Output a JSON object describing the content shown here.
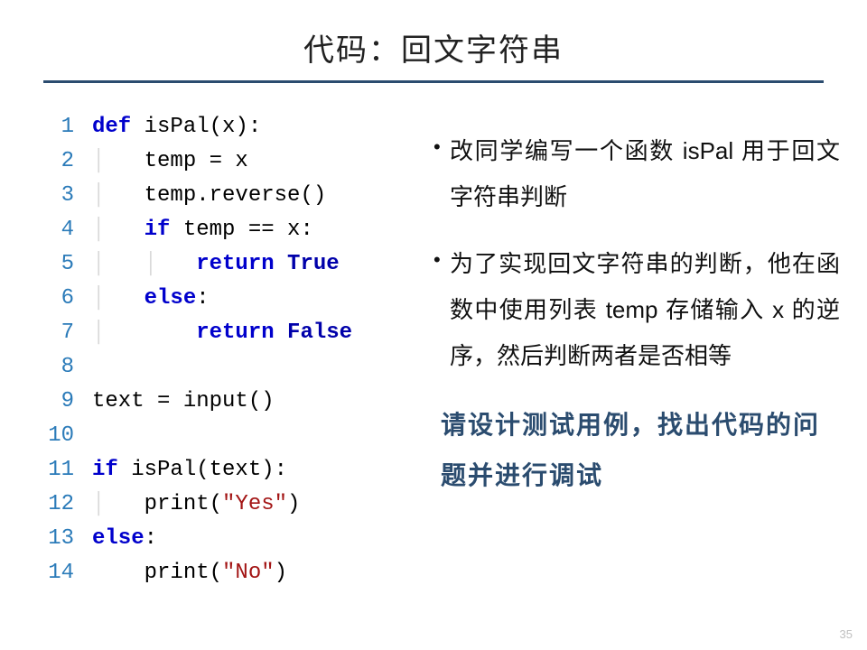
{
  "title": "代码：回文字符串",
  "code": {
    "lines": [
      {
        "n": 1,
        "html": "<span class='kw'>def</span> <span class='fn'>isPal</span><span class='txt'>(x):</span>"
      },
      {
        "n": 2,
        "html": "<span class='guide'>│   </span><span class='txt'>temp = x</span>"
      },
      {
        "n": 3,
        "html": "<span class='guide'>│   </span><span class='txt'>temp.reverse()</span>"
      },
      {
        "n": 4,
        "html": "<span class='guide'>│   </span><span class='kw'>if</span><span class='txt'> temp == x:</span>"
      },
      {
        "n": 5,
        "html": "<span class='guide'>│   │   </span><span class='kw'>return</span> <span class='bool'>True</span>"
      },
      {
        "n": 6,
        "html": "<span class='guide'>│   </span><span class='kw'>else</span><span class='txt'>:</span>"
      },
      {
        "n": 7,
        "html": "<span class='guide'>│       </span><span class='kw'>return</span> <span class='bool'>False</span>"
      },
      {
        "n": 8,
        "html": ""
      },
      {
        "n": 9,
        "html": "<span class='txt'>text = input()</span>"
      },
      {
        "n": 10,
        "html": ""
      },
      {
        "n": 11,
        "html": "<span class='kw'>if</span><span class='txt'> isPal(text):</span>"
      },
      {
        "n": 12,
        "html": "<span class='guide'>│   </span><span class='txt'>print(</span><span class='str'>\"Yes\"</span><span class='txt'>)</span>"
      },
      {
        "n": 13,
        "html": "<span class='kw'>else</span><span class='txt'>:</span>"
      },
      {
        "n": 14,
        "html": "    <span class='txt'>print(</span><span class='str'>\"No\"</span><span class='txt'>)</span>"
      }
    ]
  },
  "bullets": [
    "改同学编写一个函数 isPal 用于回文字符串判断",
    "为了实现回文字符串的判断，他在函数中使用列表 temp 存储输入 x 的逆序，然后判断两者是否相等"
  ],
  "emphasis": "请设计测试用例，找出代码的问题并进行调试",
  "page_number": "35"
}
